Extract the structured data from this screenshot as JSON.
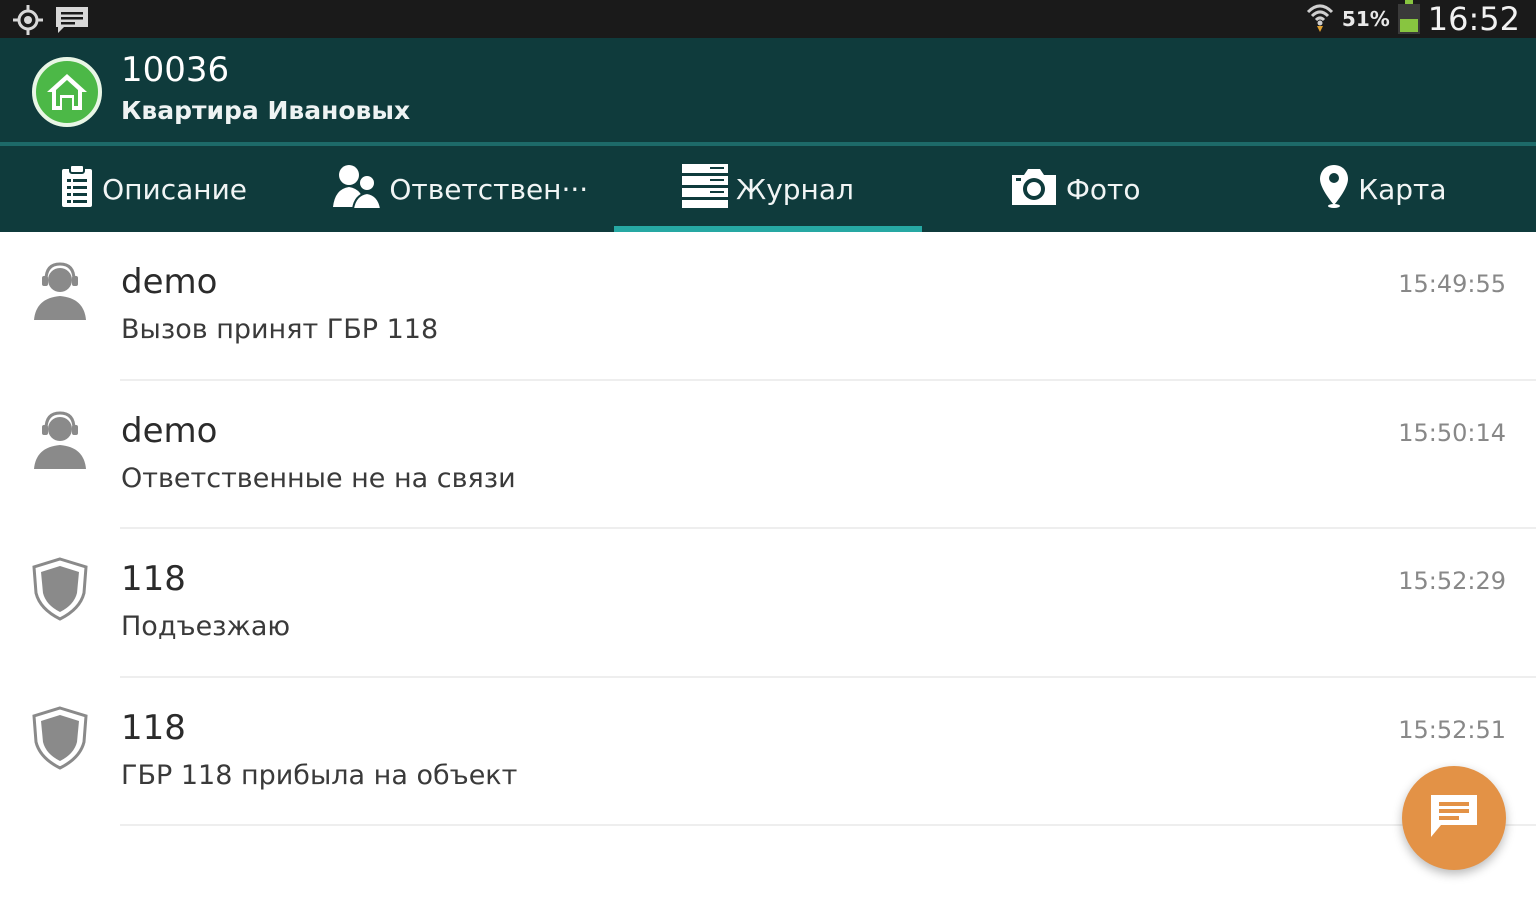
{
  "status_bar": {
    "icons_left": [
      "gps-icon",
      "message-icon"
    ],
    "icons_right": [
      "wifi-icon",
      "battery-icon"
    ],
    "battery_percent": "51%",
    "battery_level": 0.51,
    "clock": "16:52"
  },
  "header": {
    "logo_icon": "home-icon",
    "object_id": "10036",
    "object_name": "Квартира Ивановых",
    "brand_color": "#0f3b3c",
    "logo_color": "#4cb847"
  },
  "tabs": [
    {
      "label": "Описание",
      "icon": "clipboard-icon",
      "active": false
    },
    {
      "label": "Ответствен···",
      "icon": "people-icon",
      "active": false
    },
    {
      "label": "Журнал",
      "icon": "journal-icon",
      "active": true
    },
    {
      "label": "Фото",
      "icon": "camera-icon",
      "active": false
    },
    {
      "label": "Карта",
      "icon": "map-pin-icon",
      "active": false
    }
  ],
  "journal": [
    {
      "author": "demo",
      "message": "Вызов принят ГБР 118",
      "time": "15:49:55",
      "icon": "operator-icon"
    },
    {
      "author": "demo",
      "message": "Ответственные не на связи",
      "time": "15:50:14",
      "icon": "operator-icon"
    },
    {
      "author": "118",
      "message": "Подъезжаю",
      "time": "15:52:29",
      "icon": "shield-icon"
    },
    {
      "author": "118",
      "message": "ГБР 118 прибыла на объект",
      "time": "15:52:51",
      "icon": "shield-icon"
    }
  ],
  "fab": {
    "icon": "chat-icon",
    "color": "#e39246"
  },
  "colors": {
    "accent_indicator": "#26a8a3",
    "time_text": "#888888"
  }
}
